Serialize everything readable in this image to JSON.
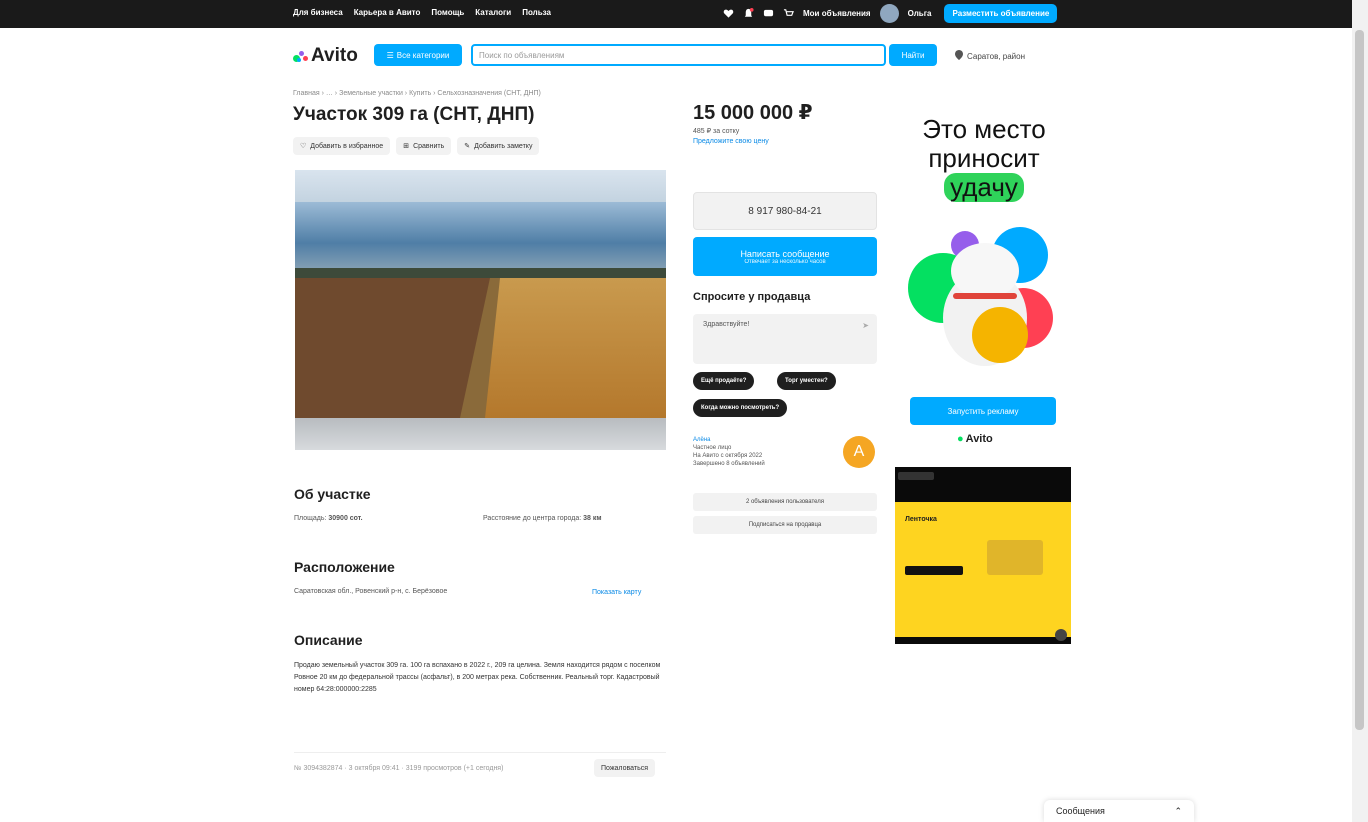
{
  "topbar": {
    "links": [
      "Для бизнеса",
      "Карьера в Авито",
      "Помощь",
      "Каталоги",
      "Польза"
    ],
    "my_ads": "Мои объявления",
    "user": "Ольга",
    "post_ad": "Разместить объявление"
  },
  "header": {
    "logo": "Avito",
    "categories": "Все категории",
    "search_placeholder": "Поиск по объявлениям",
    "search_button": "Найти",
    "city": "Саратов, район"
  },
  "listing": {
    "breadcrumbs": "Главная › … › Земельные участки › Купить › Сельхозназначения (СНТ, ДНП)",
    "title": "Участок 309 га (СНТ, ДНП)",
    "actions": [
      "Добавить в избранное",
      "Сравнить",
      "Добавить заметку"
    ],
    "price": "15 000 000 ₽",
    "price_per": "485 ₽ за сотку",
    "price_link": "Предложите свою цену"
  },
  "about": {
    "heading": "Об участке",
    "area_label": "Площадь:",
    "area_value": "30900 сот.",
    "distance_label": "Расстояние до центра города:",
    "distance_value": "38 км"
  },
  "location": {
    "heading": "Расположение",
    "address": "Саратовская обл., Ровенский р-н, с. Берёзовое",
    "map_link": "Показать карту"
  },
  "description": {
    "heading": "Описание",
    "text": "Продаю земельный участок 309 га. 100 га вспахано в 2022 г., 209 га целина. Земля находится рядом с поселком Ровное 20 км до федеральной трассы (асфальт), в 200 метрах река. Собственник. Реальный торг. Кадастровый номер 64:28:000000:2285"
  },
  "footer_row": {
    "meta": "№ 3094382874 · 3 октября 09:41 · 3199 просмотров (+1 сегодня)",
    "report": "Пожаловаться"
  },
  "contact": {
    "phone": "8 917 980-84-21",
    "write_btn": "Написать сообщение",
    "write_sub": "Отвечает за несколько часов",
    "ask_heading": "Спросите у продавца",
    "ask_text": "Здравствуйте!",
    "quick_questions": [
      "Ещё продаёте?",
      "Торг уместен?",
      "Когда можно посмотреть?"
    ],
    "seller_name": "Алёна",
    "seller_type": "Частное лицо",
    "seller_since": "На Авито с октября 2022",
    "seller_done": "Завершено 8 объявлений",
    "seller_initial": "А",
    "more_ads": "2 объявления пользователя",
    "subscribe": "Подписаться на продавца"
  },
  "ad": {
    "line1": "Это место",
    "line2": "приносит",
    "line3": "удачу",
    "button": "Запустить рекламу",
    "logo": "Avito"
  },
  "ad2": {
    "brand": "Ленточка"
  },
  "chat": {
    "label": "Сообщения"
  }
}
